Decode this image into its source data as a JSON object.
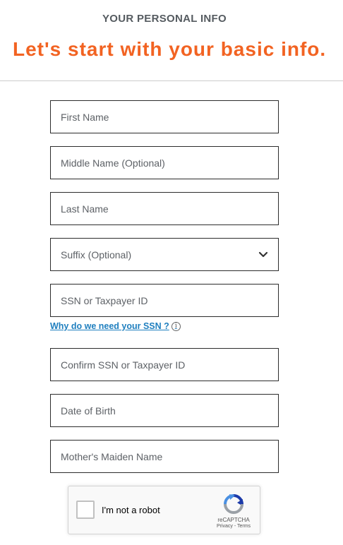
{
  "header": {
    "section_label": "YOUR PERSONAL INFO",
    "headline": "Let's start with your basic info."
  },
  "form": {
    "first_name": {
      "placeholder": "First Name",
      "value": ""
    },
    "middle_name": {
      "placeholder": "Middle Name (Optional)",
      "value": ""
    },
    "last_name": {
      "placeholder": "Last Name",
      "value": ""
    },
    "suffix": {
      "selected": "Suffix (Optional)"
    },
    "ssn": {
      "placeholder": "SSN or Taxpayer ID",
      "value": ""
    },
    "ssn_help_link": "Why do we need your SSN ?",
    "confirm_ssn": {
      "placeholder": "Confirm SSN or Taxpayer ID",
      "value": ""
    },
    "date_of_birth": {
      "placeholder": "Date of Birth",
      "value": ""
    },
    "mothers_maiden_name": {
      "placeholder": "Mother's Maiden Name",
      "value": ""
    }
  },
  "recaptcha": {
    "label": "I'm not a robot",
    "brand": "reCAPTCHA",
    "privacy": "Privacy",
    "separator": " - ",
    "terms": "Terms"
  },
  "icons": {
    "chevron": "chevron-down-icon",
    "info": "info-icon",
    "recaptcha": "recaptcha-logo-icon"
  },
  "colors": {
    "accent": "#f26322",
    "link": "#1f7fbf",
    "label": "#555b60",
    "field_border": "#2c2c2c"
  }
}
